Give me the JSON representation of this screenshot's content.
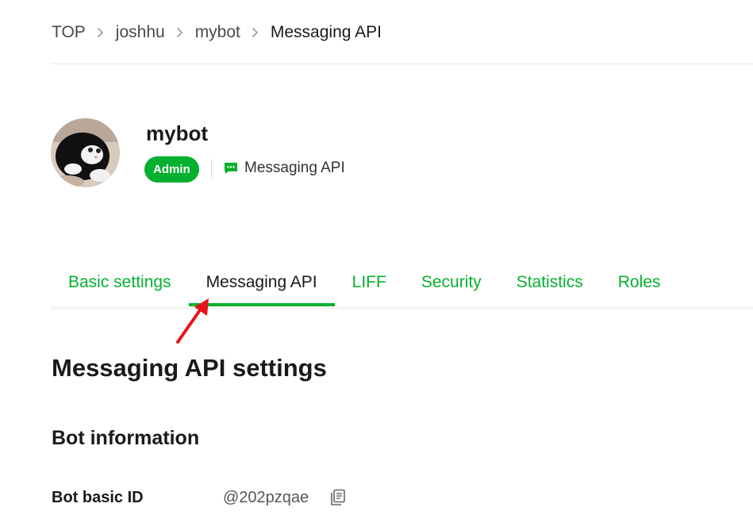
{
  "breadcrumb": {
    "items": [
      "TOP",
      "joshhu",
      "mybot",
      "Messaging API"
    ]
  },
  "channel": {
    "name": "mybot",
    "role_badge": "Admin",
    "type_label": "Messaging API",
    "type_icon": "chat-bubble-icon",
    "avatar": "cat-avatar"
  },
  "tabs": [
    {
      "label": "Basic settings",
      "active": false
    },
    {
      "label": "Messaging API",
      "active": true
    },
    {
      "label": "LIFF",
      "active": false
    },
    {
      "label": "Security",
      "active": false
    },
    {
      "label": "Statistics",
      "active": false
    },
    {
      "label": "Roles",
      "active": false
    }
  ],
  "main": {
    "section_title": "Messaging API settings",
    "bot_info": {
      "title": "Bot information",
      "basic_id_label": "Bot basic ID",
      "basic_id_value": "@202pzqae",
      "copy_icon": "copy-icon"
    }
  },
  "colors": {
    "brand_green": "#06b02f",
    "annotation_red": "#e8141c"
  }
}
